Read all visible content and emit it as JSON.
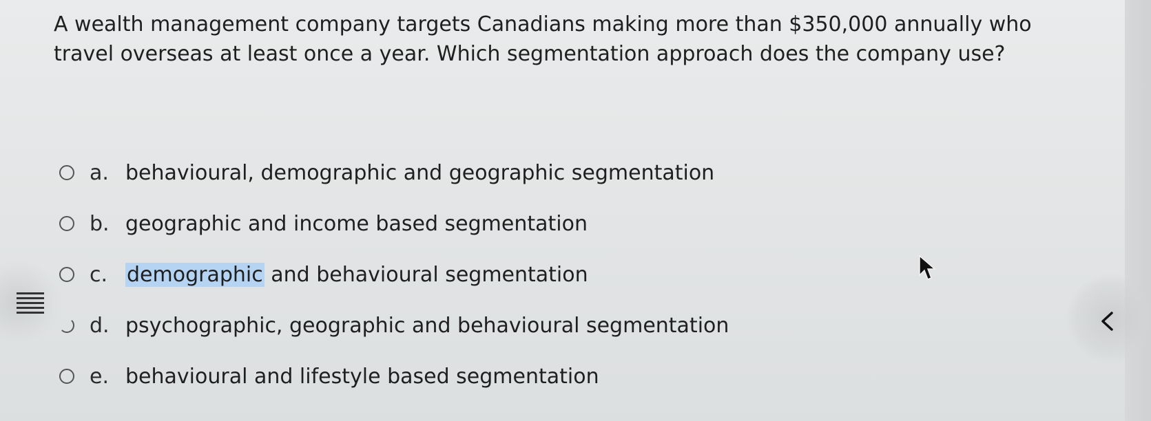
{
  "question": {
    "text": "A wealth management company targets Canadians making more than $350,000 annually who travel overseas at least once a year. Which segmentation approach does the company use?"
  },
  "options": [
    {
      "letter": "a.",
      "text": "behavioural, demographic and geographic segmentation"
    },
    {
      "letter": "b.",
      "text": "geographic and income based segmentation"
    },
    {
      "letter": "c.",
      "text_highlighted": "demographic",
      "text_rest": " and behavioural segmentation"
    },
    {
      "letter": "d.",
      "text": "psychographic, geographic and behavioural segmentation"
    },
    {
      "letter": "e.",
      "text": "behavioural and lifestyle based segmentation"
    }
  ],
  "icons": {
    "list": "list-icon",
    "nav": "chevron-left-icon",
    "cursor": "mouse-pointer-icon"
  },
  "colors": {
    "highlight": "#b5d4f4",
    "text": "#1f1f1f"
  }
}
